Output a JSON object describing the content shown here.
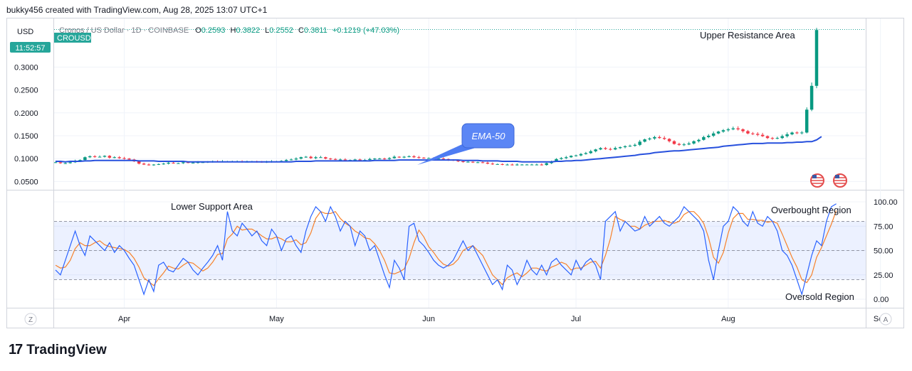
{
  "header": {
    "text": "bukky456 created with TradingView.com, Aug 28, 2025 13:07 UTC+1"
  },
  "brand": {
    "logo": "17",
    "name": "TradingView"
  },
  "chart_data": {
    "type": "candlestick",
    "title": "Cronos / US Dollar · 1D · COINBASE",
    "ohlc": {
      "o_label": "O",
      "o": "0.2593",
      "h_label": "H",
      "h": "0.3822",
      "l_label": "L",
      "l": "0.2552",
      "c_label": "C",
      "c": "0.3811",
      "change": "+0.1219 (+47.03%)"
    },
    "currency": "USD",
    "symbol_badge": "CROUSD",
    "countdown": "11:52:57",
    "price_axis": {
      "ticks": [
        "0.3000",
        "0.2500",
        "0.2000",
        "0.1500",
        "0.1000",
        "0.0500"
      ],
      "values": [
        0.3,
        0.25,
        0.2,
        0.15,
        0.1,
        0.05
      ],
      "ylim": [
        0.035,
        0.4
      ]
    },
    "time_axis": {
      "ticks": [
        "Apr",
        "May",
        "Jun",
        "Jul",
        "Aug",
        "Sep"
      ]
    },
    "annotations": {
      "upper_resistance": "Upper Resistance Area",
      "ema_label": "EMA-50",
      "lower_support": "Lower Support Area",
      "overbought": "Overbought Region",
      "oversold": "Oversold Region"
    },
    "price_series": [
      0.092,
      0.09,
      0.09,
      0.092,
      0.095,
      0.097,
      0.103,
      0.105,
      0.104,
      0.104,
      0.106,
      0.102,
      0.103,
      0.101,
      0.1,
      0.098,
      0.094,
      0.089,
      0.087,
      0.086,
      0.087,
      0.088,
      0.089,
      0.091,
      0.09,
      0.09,
      0.092,
      0.091,
      0.091,
      0.092,
      0.092,
      0.093,
      0.094,
      0.093,
      0.094,
      0.094,
      0.094,
      0.094,
      0.093,
      0.093,
      0.094,
      0.093,
      0.092,
      0.093,
      0.094,
      0.094,
      0.095,
      0.097,
      0.098,
      0.1,
      0.103,
      0.104,
      0.101,
      0.103,
      0.103,
      0.1,
      0.099,
      0.098,
      0.098,
      0.097,
      0.097,
      0.098,
      0.097,
      0.097,
      0.099,
      0.1,
      0.1,
      0.099,
      0.101,
      0.104,
      0.103,
      0.104,
      0.105,
      0.103,
      0.102,
      0.101,
      0.101,
      0.1,
      0.1,
      0.099,
      0.097,
      0.096,
      0.094,
      0.093,
      0.093,
      0.092,
      0.092,
      0.091,
      0.089,
      0.088,
      0.088,
      0.087,
      0.087,
      0.086,
      0.087,
      0.087,
      0.087,
      0.087,
      0.087,
      0.086,
      0.09,
      0.094,
      0.099,
      0.101,
      0.103,
      0.106,
      0.107,
      0.11,
      0.112,
      0.116,
      0.12,
      0.123,
      0.121,
      0.12,
      0.123,
      0.125,
      0.127,
      0.128,
      0.13,
      0.137,
      0.142,
      0.144,
      0.147,
      0.145,
      0.143,
      0.138,
      0.132,
      0.13,
      0.131,
      0.133,
      0.138,
      0.141,
      0.147,
      0.15,
      0.155,
      0.159,
      0.162,
      0.164,
      0.166,
      0.164,
      0.16,
      0.155,
      0.154,
      0.152,
      0.149,
      0.145,
      0.144,
      0.145,
      0.149,
      0.153,
      0.157,
      0.156,
      0.157,
      0.207,
      0.259,
      0.381
    ],
    "ema50": {
      "name": "EMA-50",
      "values": [
        0.094,
        0.094,
        0.093,
        0.094,
        0.094,
        0.094,
        0.095,
        0.095,
        0.096,
        0.096,
        0.096,
        0.096,
        0.096,
        0.096,
        0.096,
        0.096,
        0.096,
        0.095,
        0.095,
        0.095,
        0.095,
        0.094,
        0.094,
        0.094,
        0.094,
        0.094,
        0.094,
        0.093,
        0.093,
        0.093,
        0.093,
        0.093,
        0.093,
        0.093,
        0.093,
        0.093,
        0.093,
        0.093,
        0.093,
        0.093,
        0.093,
        0.093,
        0.093,
        0.093,
        0.093,
        0.093,
        0.093,
        0.093,
        0.093,
        0.094,
        0.094,
        0.094,
        0.094,
        0.095,
        0.095,
        0.095,
        0.095,
        0.095,
        0.095,
        0.095,
        0.095,
        0.095,
        0.095,
        0.095,
        0.095,
        0.096,
        0.096,
        0.096,
        0.096,
        0.096,
        0.097,
        0.097,
        0.097,
        0.097,
        0.097,
        0.097,
        0.097,
        0.097,
        0.097,
        0.097,
        0.097,
        0.097,
        0.097,
        0.096,
        0.096,
        0.096,
        0.096,
        0.095,
        0.095,
        0.095,
        0.095,
        0.094,
        0.094,
        0.094,
        0.094,
        0.093,
        0.093,
        0.093,
        0.093,
        0.093,
        0.093,
        0.093,
        0.094,
        0.094,
        0.095,
        0.095,
        0.096,
        0.096,
        0.097,
        0.098,
        0.099,
        0.1,
        0.101,
        0.102,
        0.103,
        0.104,
        0.105,
        0.106,
        0.107,
        0.109,
        0.11,
        0.111,
        0.113,
        0.114,
        0.115,
        0.116,
        0.117,
        0.117,
        0.118,
        0.119,
        0.12,
        0.121,
        0.122,
        0.123,
        0.124,
        0.125,
        0.127,
        0.128,
        0.129,
        0.13,
        0.131,
        0.132,
        0.133,
        0.133,
        0.133,
        0.134,
        0.134,
        0.134,
        0.134,
        0.135,
        0.135,
        0.136,
        0.136,
        0.137,
        0.137,
        0.141,
        0.148
      ]
    },
    "stoch_axis": {
      "ticks": [
        "100.00",
        "75.00",
        "50.00",
        "25.00",
        "0.00"
      ],
      "values": [
        100,
        75,
        50,
        25,
        0
      ],
      "bands": [
        80,
        50,
        20
      ]
    },
    "stoch_k": {
      "values": [
        30,
        25,
        40,
        55,
        70,
        55,
        45,
        65,
        60,
        55,
        50,
        58,
        48,
        55,
        50,
        42,
        35,
        20,
        5,
        20,
        8,
        35,
        38,
        30,
        28,
        35,
        42,
        38,
        30,
        25,
        32,
        38,
        45,
        55,
        40,
        90,
        70,
        65,
        78,
        72,
        65,
        70,
        60,
        55,
        72,
        65,
        50,
        62,
        65,
        55,
        48,
        70,
        85,
        95,
        90,
        80,
        95,
        85,
        70,
        80,
        75,
        55,
        70,
        65,
        50,
        55,
        40,
        25,
        12,
        40,
        32,
        20,
        75,
        78,
        60,
        55,
        48,
        40,
        35,
        32,
        35,
        40,
        50,
        60,
        50,
        55,
        45,
        35,
        25,
        15,
        20,
        10,
        35,
        30,
        15,
        25,
        40,
        30,
        25,
        35,
        25,
        38,
        42,
        35,
        30,
        25,
        40,
        30,
        38,
        42,
        35,
        20,
        80,
        85,
        90,
        70,
        80,
        75,
        70,
        72,
        85,
        75,
        80,
        85,
        78,
        75,
        80,
        85,
        95,
        90,
        85,
        80,
        70,
        40,
        20,
        50,
        75,
        80,
        95,
        90,
        80,
        75,
        90,
        78,
        75,
        85,
        80,
        70,
        50,
        45,
        35,
        20,
        5,
        25,
        45,
        60,
        55,
        80,
        95,
        98
      ]
    },
    "stoch_d": {
      "values": [
        35,
        32,
        33,
        40,
        52,
        58,
        55,
        55,
        58,
        60,
        56,
        54,
        53,
        52,
        51,
        48,
        42,
        33,
        22,
        18,
        14,
        21,
        27,
        34,
        32,
        31,
        35,
        38,
        37,
        33,
        29,
        32,
        38,
        46,
        47,
        62,
        67,
        75,
        71,
        72,
        72,
        69,
        65,
        62,
        62,
        64,
        62,
        59,
        59,
        61,
        56,
        58,
        68,
        83,
        90,
        88,
        88,
        90,
        83,
        78,
        75,
        70,
        67,
        63,
        62,
        57,
        50,
        40,
        27,
        26,
        28,
        31,
        42,
        58,
        71,
        64,
        54,
        48,
        41,
        36,
        34,
        36,
        41,
        50,
        53,
        55,
        50,
        45,
        35,
        25,
        20,
        15,
        22,
        25,
        27,
        23,
        27,
        32,
        32,
        30,
        29,
        33,
        35,
        38,
        36,
        30,
        32,
        32,
        35,
        38,
        39,
        32,
        45,
        62,
        85,
        82,
        80,
        75,
        75,
        72,
        76,
        78,
        80,
        80,
        81,
        79,
        78,
        80,
        87,
        90,
        90,
        85,
        78,
        63,
        43,
        37,
        48,
        68,
        83,
        88,
        88,
        82,
        82,
        81,
        81,
        79,
        80,
        78,
        67,
        55,
        43,
        33,
        20,
        17,
        25,
        43,
        53,
        65,
        77,
        91
      ]
    }
  }
}
